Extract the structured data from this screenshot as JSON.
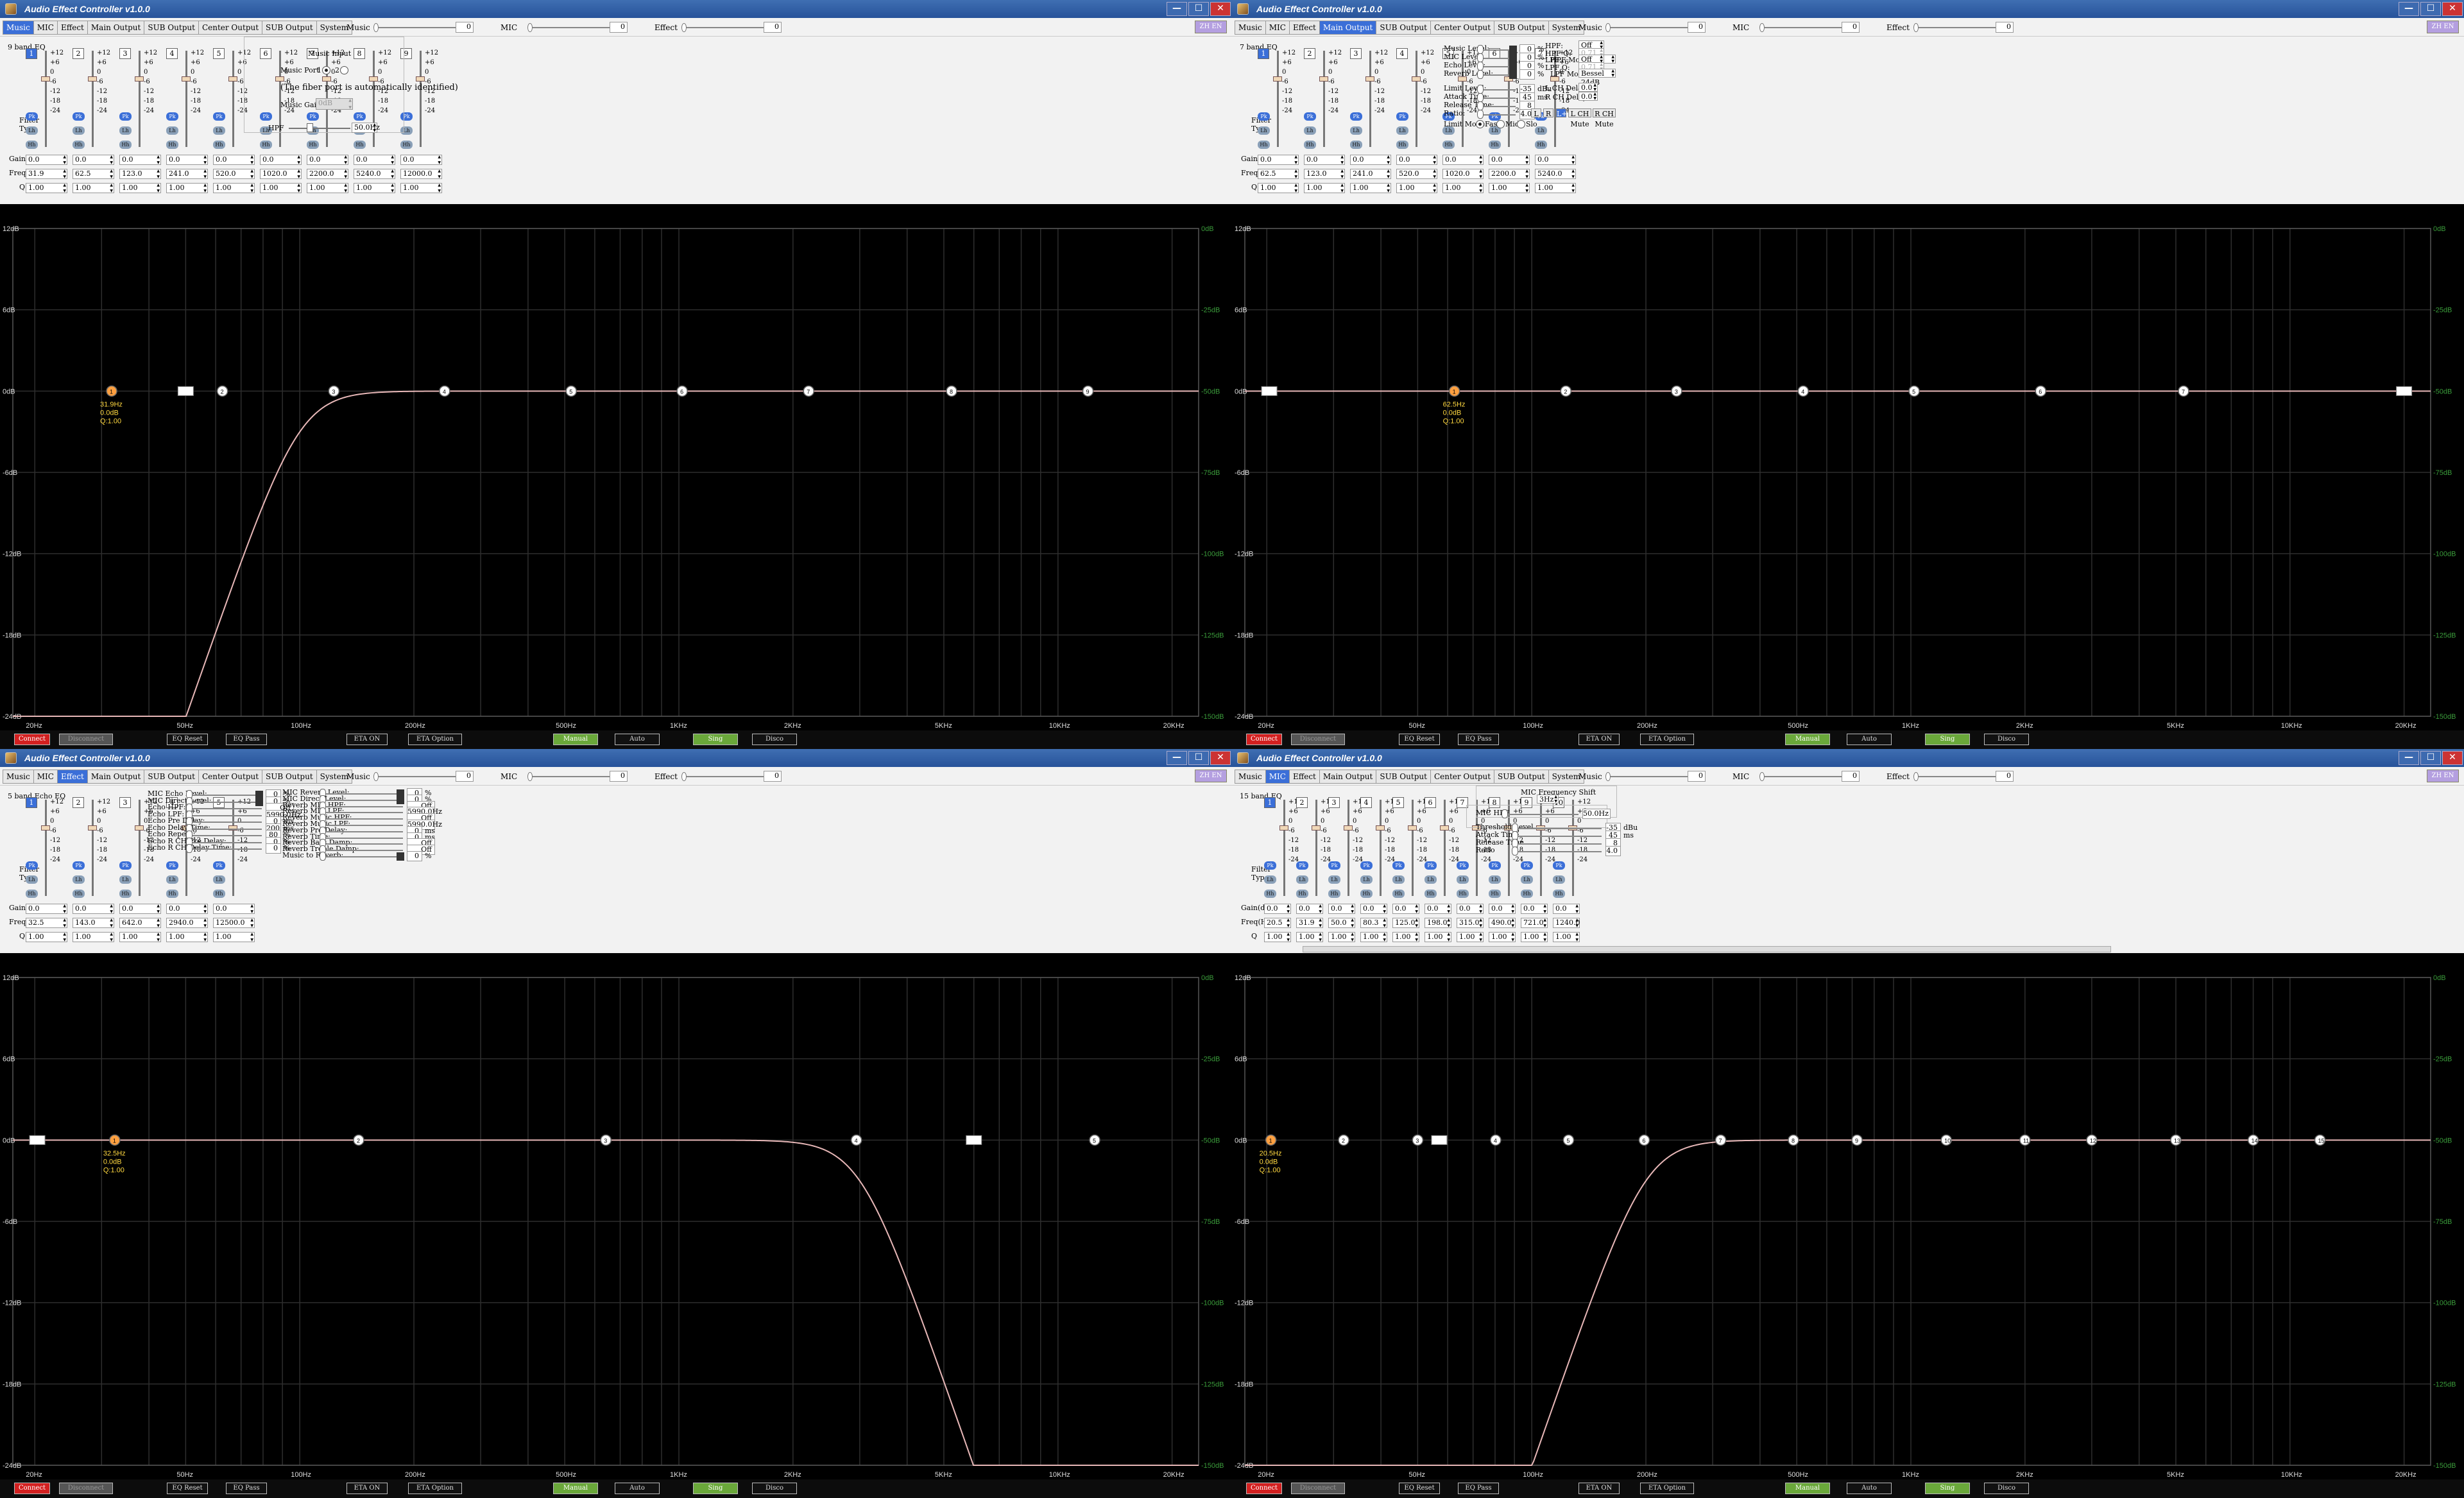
{
  "title": "Audio Effect Controller v1.0.0",
  "tabs": [
    "Music",
    "MIC",
    "Effect",
    "Main Output",
    "SUB Output",
    "Center Output",
    "SUB Output",
    "System"
  ],
  "top_controls": {
    "music_label": "Music",
    "music_value": "0",
    "mic_label": "MIC",
    "mic_value": "0",
    "effect_label": "Effect",
    "effect_value": "0"
  },
  "window_buttons": {
    "min": "—",
    "max": "☐",
    "close": "✕"
  },
  "lang_label": "ZH EN",
  "row_labels": {
    "gain": "Gain(dB)",
    "freq": "Freq(Hz)",
    "q": "Q",
    "filter_type": "Filter\nType"
  },
  "scale_ticks": [
    "+12",
    "+6",
    "0",
    "-6",
    "-12",
    "-18",
    "-24"
  ],
  "filter_buttons": [
    "Pk",
    "Lh",
    "Hh"
  ],
  "plot": {
    "y_ticks": [
      "12dB",
      "6dB",
      "0dB",
      "-6dB",
      "-12dB",
      "-18dB",
      "-24dB"
    ],
    "right_ticks": [
      "0dB",
      "-25dB",
      "-50dB",
      "-75dB",
      "-100dB",
      "-125dB",
      "-150dB"
    ],
    "x_ticks": [
      "20Hz",
      "50Hz",
      "100Hz",
      "200Hz",
      "500Hz",
      "1KHz",
      "2KHz",
      "5KHz",
      "10KHz",
      "20KHz"
    ]
  },
  "status": {
    "connect": "Connect",
    "disconnect": "Disconnect",
    "eq_reset": "EQ Reset",
    "eq_pass": "EQ Pass",
    "eta_on": "ETA ON",
    "eta_option": "ETA Option",
    "manual": "Manual",
    "auto": "Auto",
    "sing": "Sing",
    "disco": "Disco"
  },
  "windows": [
    {
      "active_tab": 0,
      "eq_title": "9 band EQ",
      "bands": [
        {
          "n": "1",
          "gain": "0.0",
          "freq": "31.9",
          "q": "1.00"
        },
        {
          "n": "2",
          "gain": "0.0",
          "freq": "62.5",
          "q": "1.00"
        },
        {
          "n": "3",
          "gain": "0.0",
          "freq": "123.0",
          "q": "1.00"
        },
        {
          "n": "4",
          "gain": "0.0",
          "freq": "241.0",
          "q": "1.00"
        },
        {
          "n": "5",
          "gain": "0.0",
          "freq": "520.0",
          "q": "1.00"
        },
        {
          "n": "6",
          "gain": "0.0",
          "freq": "1020.0",
          "q": "1.00"
        },
        {
          "n": "7",
          "gain": "0.0",
          "freq": "2200.0",
          "q": "1.00"
        },
        {
          "n": "8",
          "gain": "0.0",
          "freq": "5240.0",
          "q": "1.00"
        },
        {
          "n": "9",
          "gain": "0.0",
          "freq": "12000.0",
          "q": "1.00"
        }
      ],
      "right": {
        "music_input": "Music Input",
        "music_port": "Music Port",
        "port1": "1",
        "port2": "2",
        "fiber_note": "(The fiber port is automatically identified)",
        "music_gain_label": "Music Gain",
        "music_gain_value": "0dB",
        "hpf_label": "HPF",
        "hpf_value": "50.0Hz"
      },
      "curve": "hpf",
      "hpf_knee_hz": 100,
      "node_freqs": [
        31.9,
        62.5,
        123,
        241,
        520,
        1020,
        2200,
        5240,
        12000
      ],
      "node_labels": [
        "1",
        "2",
        "3",
        "4",
        "5",
        "6",
        "7",
        "8",
        "9"
      ],
      "hpf_marker_hz": 50,
      "selected_info": [
        "31.9Hz",
        "0.0dB",
        "Q:1.00"
      ]
    },
    {
      "active_tab": 3,
      "eq_title": "7 band EQ",
      "bands": [
        {
          "n": "1",
          "gain": "0.0",
          "freq": "62.5",
          "q": "1.00"
        },
        {
          "n": "2",
          "gain": "0.0",
          "freq": "123.0",
          "q": "1.00"
        },
        {
          "n": "3",
          "gain": "0.0",
          "freq": "241.0",
          "q": "1.00"
        },
        {
          "n": "4",
          "gain": "0.0",
          "freq": "520.0",
          "q": "1.00"
        },
        {
          "n": "5",
          "gain": "0.0",
          "freq": "1020.0",
          "q": "1.00"
        },
        {
          "n": "6",
          "gain": "0.0",
          "freq": "2200.0",
          "q": "1.00"
        },
        {
          "n": "7",
          "gain": "0.0",
          "freq": "5240.0",
          "q": "1.00"
        }
      ],
      "levels": [
        {
          "label": "Music Level:",
          "value": "0",
          "unit": "%"
        },
        {
          "label": "MIC Level:",
          "value": "0",
          "unit": "%"
        },
        {
          "label": "Echo Level:",
          "value": "0",
          "unit": "%"
        },
        {
          "label": "Reverb Level:",
          "value": "0",
          "unit": "%"
        }
      ],
      "limit": [
        {
          "label": "Limit Level:",
          "value": "-35",
          "unit": "dBu"
        },
        {
          "label": "Attack Time:",
          "value": "45",
          "unit": "ms"
        },
        {
          "label": "Release Time:",
          "value": "8",
          "unit": "",
          "prefix": "AR ×"
        },
        {
          "label": "Ratio:",
          "value": "4.0",
          "unit": ""
        }
      ],
      "limit_mode_label": "Limit Mode",
      "limit_modes": [
        "Fast",
        "Mid",
        "Slo"
      ],
      "filters": {
        "hpf_label": "HPF:",
        "hpf_value": "Off",
        "hpf_q_label": "HPF Q:",
        "hpf_q_value": "0.71",
        "hpf_mode_label": "HPF Mode",
        "hpf_mode_value": "Bessel 24dB",
        "lpf_label": "LPF:",
        "lpf_value": "Off",
        "lpf_q_label": "LPF Q:",
        "lpf_q_value": "0.71",
        "lpf_mode_label": "LPF Mode",
        "lpf_mode_value": "Bessel 24dB",
        "lch_delay_label": "L CH Delay:",
        "lch_delay_value": "0.0",
        "rch_delay_label": "R CH Delay:",
        "rch_delay_value": "0.0",
        "delay_unit": "ms"
      },
      "ch_buttons": [
        "L",
        "R",
        "L+R",
        "L CH Mute",
        "R CH Mute"
      ],
      "curve": "flat",
      "node_freqs": [
        62.5,
        123,
        241,
        520,
        1020,
        2200,
        5240
      ],
      "node_labels": [
        "1",
        "2",
        "3",
        "4",
        "5",
        "6",
        "7"
      ],
      "hpf_marker_hz": 20.3,
      "lpf_marker_hz": 20000,
      "selected_info": [
        "62.5Hz",
        "0.0dB",
        "Q:1.00"
      ]
    },
    {
      "active_tab": 2,
      "eq_title": "5 band Echo EQ",
      "bands": [
        {
          "n": "1",
          "gain": "0.0",
          "freq": "32.5",
          "q": "1.00"
        },
        {
          "n": "2",
          "gain": "0.0",
          "freq": "143.0",
          "q": "1.00"
        },
        {
          "n": "3",
          "gain": "0.0",
          "freq": "642.0",
          "q": "1.00"
        },
        {
          "n": "4",
          "gain": "0.0",
          "freq": "2940.0",
          "q": "1.00"
        },
        {
          "n": "5",
          "gain": "0.0",
          "freq": "12500.0",
          "q": "1.00"
        }
      ],
      "echo_col": [
        {
          "label": "MIC Echo Level:",
          "value": "0",
          "unit": "%",
          "kind": "blk"
        },
        {
          "label": "MIC Direct Level:",
          "value": "0",
          "unit": "%",
          "kind": "blk"
        },
        {
          "label": "Echo HPF:",
          "value": "Off",
          "unit": "",
          "kind": "sel"
        },
        {
          "label": "Echo LPF:",
          "value": "5990.0Hz",
          "unit": "",
          "kind": "sel"
        },
        {
          "label": "Echo Pre Delay:",
          "value": "0",
          "unit": "ms",
          "kind": "num"
        },
        {
          "label": "Echo Delay Time:",
          "value": "200",
          "unit": "ms",
          "kind": "num"
        },
        {
          "label": "Echo Repeat:",
          "value": "80",
          "unit": "%",
          "kind": "num"
        },
        {
          "label": "Echo R CH Pre Delay:",
          "value": "0",
          "unit": "%",
          "kind": "num"
        },
        {
          "label": "Echo R CH Delay Time:",
          "value": "0",
          "unit": "%",
          "kind": "num"
        }
      ],
      "reverb_col": [
        {
          "label": "MIC Reverb Level:",
          "value": "0",
          "unit": "%",
          "kind": "blk"
        },
        {
          "label": "MIC Direct Level:",
          "value": "0",
          "unit": "%",
          "kind": "blk"
        },
        {
          "label": "Reverb MIC HPF:",
          "value": "Off",
          "unit": "",
          "kind": "sel"
        },
        {
          "label": "Reverb MIC LPF:",
          "value": "5990.0Hz",
          "unit": "",
          "kind": "sel"
        },
        {
          "label": "Reverb Music HPF:",
          "value": "Off",
          "unit": "",
          "kind": "sel"
        },
        {
          "label": "Reverb Music LPF:",
          "value": "5990.0Hz",
          "unit": "",
          "kind": "sel"
        },
        {
          "label": "Reverb Pre Delay:",
          "value": "0",
          "unit": "ms",
          "kind": "num"
        },
        {
          "label": "Reverb Time:",
          "value": "0",
          "unit": "ms",
          "kind": "num"
        },
        {
          "label": "Reverb Bass Damp:",
          "value": "Off",
          "unit": "",
          "kind": "sel"
        },
        {
          "label": "Reverb Treble Damp:",
          "value": "Off",
          "unit": "",
          "kind": "sel"
        },
        {
          "label": "Music to Reverb:",
          "value": "0",
          "unit": "%",
          "kind": "blk"
        }
      ],
      "curve": "lpf",
      "lpf_knee_hz": 3000,
      "node_freqs": [
        32.5,
        143,
        642,
        2940,
        12500
      ],
      "node_labels": [
        "1",
        "2",
        "3",
        "4",
        "5"
      ],
      "hpf_marker_hz": 20.3,
      "lpf_marker_hz": 6000,
      "selected_info": [
        "32.5Hz",
        "0.0dB",
        "Q:1.00"
      ]
    },
    {
      "active_tab": 1,
      "eq_title": "15 band EQ",
      "bands": [
        {
          "n": "1",
          "gain": "",
          "freq": "20.5",
          "q": "1.00"
        },
        {
          "n": "2",
          "gain": "",
          "freq": "31.9",
          "q": "1.00"
        },
        {
          "n": "3",
          "gain": "",
          "freq": "50.0",
          "q": "1.00"
        },
        {
          "n": "4",
          "gain": "",
          "freq": "80.3",
          "q": "1.00"
        },
        {
          "n": "5",
          "gain": "",
          "freq": "125.0",
          "q": "1.00"
        },
        {
          "n": "6",
          "gain": "",
          "freq": "198.0",
          "q": "1.00"
        },
        {
          "n": "7",
          "gain": "",
          "freq": "315.0",
          "q": "1.00"
        },
        {
          "n": "8",
          "gain": "",
          "freq": "490.0",
          "q": "1.00"
        },
        {
          "n": "9",
          "gain": "",
          "freq": "721.0",
          "q": "1.00"
        },
        {
          "n": "10",
          "gain": "",
          "freq": "1240.0",
          "q": "1.00"
        }
      ],
      "band_gains": [
        "0.0",
        "0.0",
        "0.0",
        "0.0",
        "0.0",
        "0.0",
        "0.0",
        "0.0",
        "0.0",
        "0.0"
      ],
      "mic_right": {
        "shift_label": "MIC Frequency Shift",
        "shift_value": "3Hz",
        "hpf_label": "MIC HPF",
        "hpf_value": "50.0Hz",
        "threshold_label": "Threshold Level",
        "threshold_value": "-35",
        "threshold_unit": "dBu",
        "attack_label": "Attack Time",
        "attack_value": "45",
        "attack_unit": "ms",
        "release_label": "Release Time",
        "release_prefix": "AR ×",
        "release_value": "8",
        "ratio_label": "Ratio",
        "ratio_value": "4.0"
      },
      "curve": "hpf",
      "hpf_knee_hz": 200,
      "node_freqs": [
        20.5,
        31.9,
        50,
        80.3,
        125,
        198,
        315,
        490,
        721,
        1240,
        2000,
        3000,
        5000,
        8000,
        12000
      ],
      "node_labels": [
        "1",
        "2",
        "3",
        "4",
        "5",
        "6",
        "7",
        "8",
        "9",
        "10",
        "11",
        "12",
        "13",
        "14",
        "15"
      ],
      "hpf_marker_hz": 57,
      "hpf_marker_text": "HPF",
      "selected_info": [
        "20.5Hz",
        "0.0dB",
        "Q:1.00"
      ]
    }
  ]
}
